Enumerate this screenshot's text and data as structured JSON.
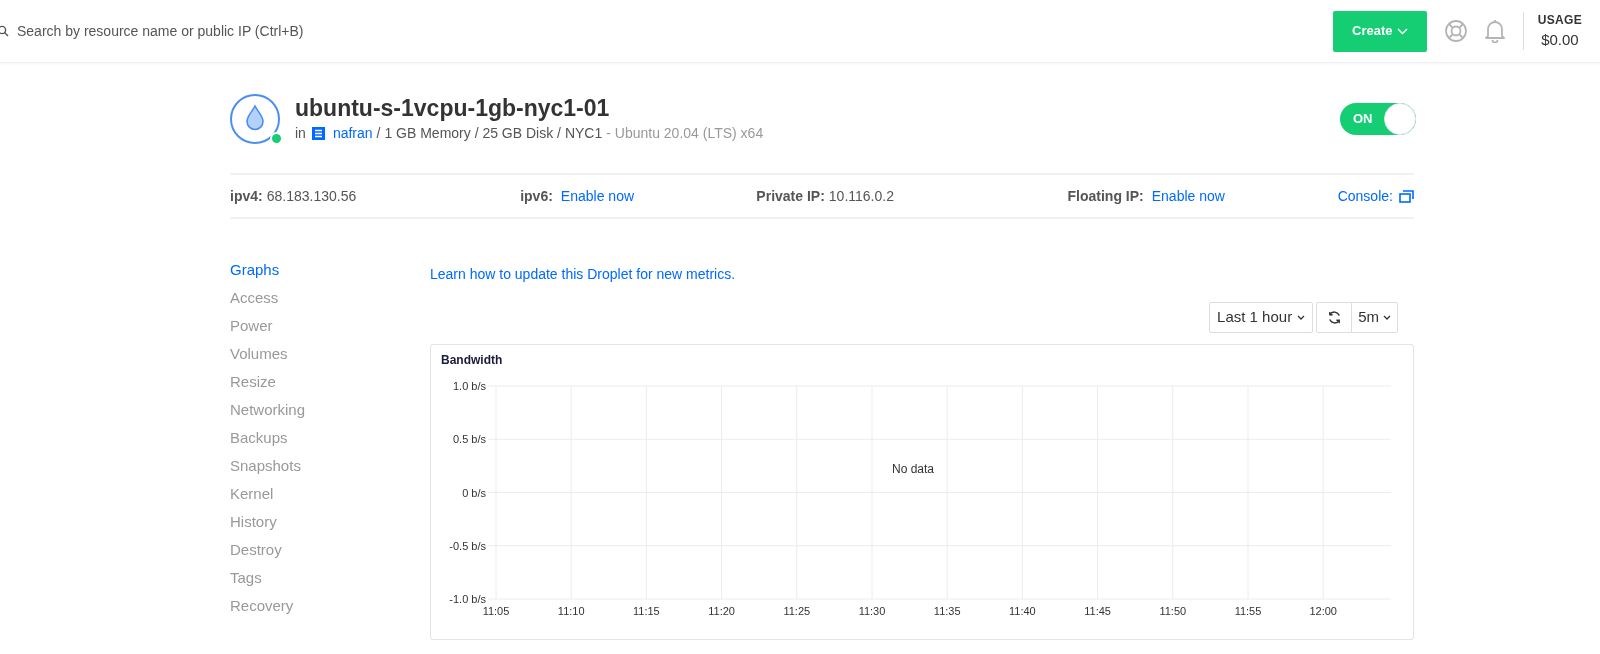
{
  "topbar": {
    "search": {
      "placeholder": "Search by resource name or public IP (Ctrl+B)"
    },
    "create_button": "Create",
    "usage": {
      "label": "USAGE",
      "amount": "$0.00"
    }
  },
  "droplet": {
    "name": "ubuntu-s-1vcpu-1gb-nyc1-01",
    "online": true,
    "prefix": "in",
    "project": "nafran",
    "specs": "/ 1 GB Memory / 25 GB Disk / NYC1",
    "image": "- Ubuntu 20.04 (LTS) x64",
    "power": {
      "on": true,
      "label": "ON"
    }
  },
  "info": [
    {
      "label": "ipv4:",
      "value": "68.183.130.56",
      "kind": "text"
    },
    {
      "label": "ipv6:",
      "value": "Enable now",
      "kind": "link"
    },
    {
      "label": "Private IP:",
      "value": "10.116.0.2",
      "kind": "text"
    },
    {
      "label": "Floating IP:",
      "value": "Enable now",
      "kind": "link"
    },
    {
      "label": "Console:",
      "kind": "console"
    }
  ],
  "sidebar": {
    "items": [
      {
        "label": "Graphs",
        "selected": true
      },
      {
        "label": "Access",
        "selected": false
      },
      {
        "label": "Power",
        "selected": false
      },
      {
        "label": "Volumes",
        "selected": false
      },
      {
        "label": "Resize",
        "selected": false
      },
      {
        "label": "Networking",
        "selected": false
      },
      {
        "label": "Backups",
        "selected": false
      },
      {
        "label": "Snapshots",
        "selected": false
      },
      {
        "label": "Kernel",
        "selected": false
      },
      {
        "label": "History",
        "selected": false
      },
      {
        "label": "Destroy",
        "selected": false
      },
      {
        "label": "Tags",
        "selected": false
      },
      {
        "label": "Recovery",
        "selected": false
      }
    ]
  },
  "main": {
    "metrics_link": "Learn how to update this Droplet for new metrics.",
    "range": "Last 1 hour",
    "interval": "5m",
    "chart": {
      "chart_data": {
        "type": "line",
        "title": "Bandwidth",
        "grid": true,
        "categories": [
          "11:05",
          "11:10",
          "11:15",
          "11:20",
          "11:25",
          "11:30",
          "11:35",
          "11:40",
          "11:45",
          "11:50",
          "11:55",
          "12:00"
        ],
        "ylim": [
          -1,
          1
        ],
        "yticks": [
          {
            "value": 1,
            "label": "1.0 b/s"
          },
          {
            "value": 0.5,
            "label": "0.5 b/s"
          },
          {
            "value": 0,
            "label": "0 b/s"
          },
          {
            "value": -0.5,
            "label": "-0.5 b/s"
          },
          {
            "value": -1,
            "label": "-1.0 b/s"
          }
        ],
        "annotations": [
          "No data"
        ]
      }
    }
  }
}
